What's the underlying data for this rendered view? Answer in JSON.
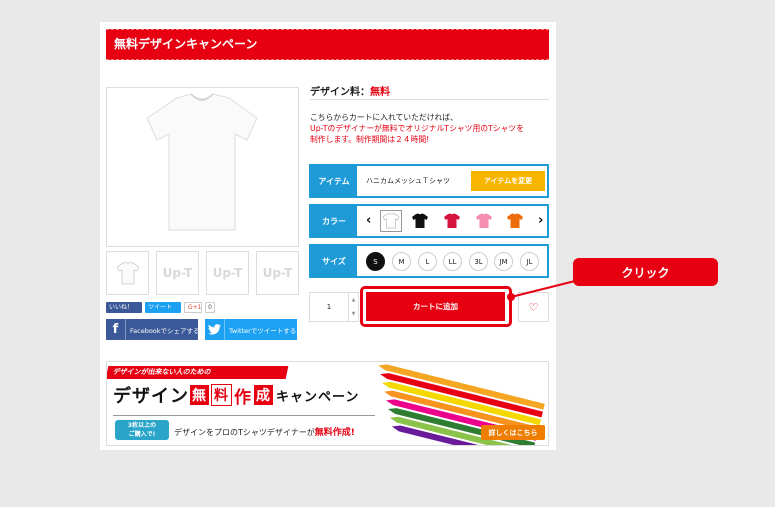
{
  "header": {
    "title": "無料デザインキャンペーン"
  },
  "gallery": {
    "thumbs": [
      "Up-T",
      "Up-T",
      "Up-T"
    ]
  },
  "social": {
    "facebook_like": "いいね！",
    "tweet": "ツイート",
    "gplus": "G+1",
    "gplus_count": "0",
    "share_facebook": "Facebookでシェアする",
    "share_twitter": "Twitterでツイートする"
  },
  "product": {
    "fee_label": "デザイン料：",
    "fee_value": "無料",
    "desc_line1": "こちらからカートに入れていただければ、",
    "desc_line2_red": "Up-Tのデザイナーが無料でオリジナルTシャツ用のTシャツを",
    "desc_line3_red": "制作します。制作期間は２４時間!"
  },
  "options": {
    "item_label": "アイテム",
    "item_name": "ハニカムメッシュＴシャツ",
    "change_button": "アイテムを変更",
    "color_label": "カラー",
    "colors": [
      {
        "name": "white",
        "hex": "#ffffff"
      },
      {
        "name": "black",
        "hex": "#111111"
      },
      {
        "name": "red",
        "hex": "#d4143c"
      },
      {
        "name": "pink",
        "hex": "#f48fb1"
      },
      {
        "name": "orange",
        "hex": "#ef6c0c"
      }
    ],
    "size_label": "サイズ",
    "sizes": [
      "S",
      "M",
      "L",
      "LL",
      "3L",
      "JM",
      "JL"
    ],
    "selected_size": "S"
  },
  "cart": {
    "quantity": "1",
    "add_to_cart": "カートに追加"
  },
  "annotation": {
    "click": "クリック"
  },
  "promo": {
    "tag": "デザインが出来ない人のための",
    "title_prefix": "デザイン",
    "title_c1": "無",
    "title_c2": "料",
    "title_c3": "作",
    "title_c4": "成",
    "title_suffix": "キャンペーン",
    "badge_line1": "3枚以上の",
    "badge_line2": "ご購入で!",
    "sub_text": "デザインをプロのTシャツデザイナーが",
    "sub_red": "無料作成!",
    "detail_button": "詳しくはこちら"
  },
  "colors": {
    "accent": "#e60012",
    "blue": "#1e9ad6",
    "yellow": "#f7b500"
  }
}
